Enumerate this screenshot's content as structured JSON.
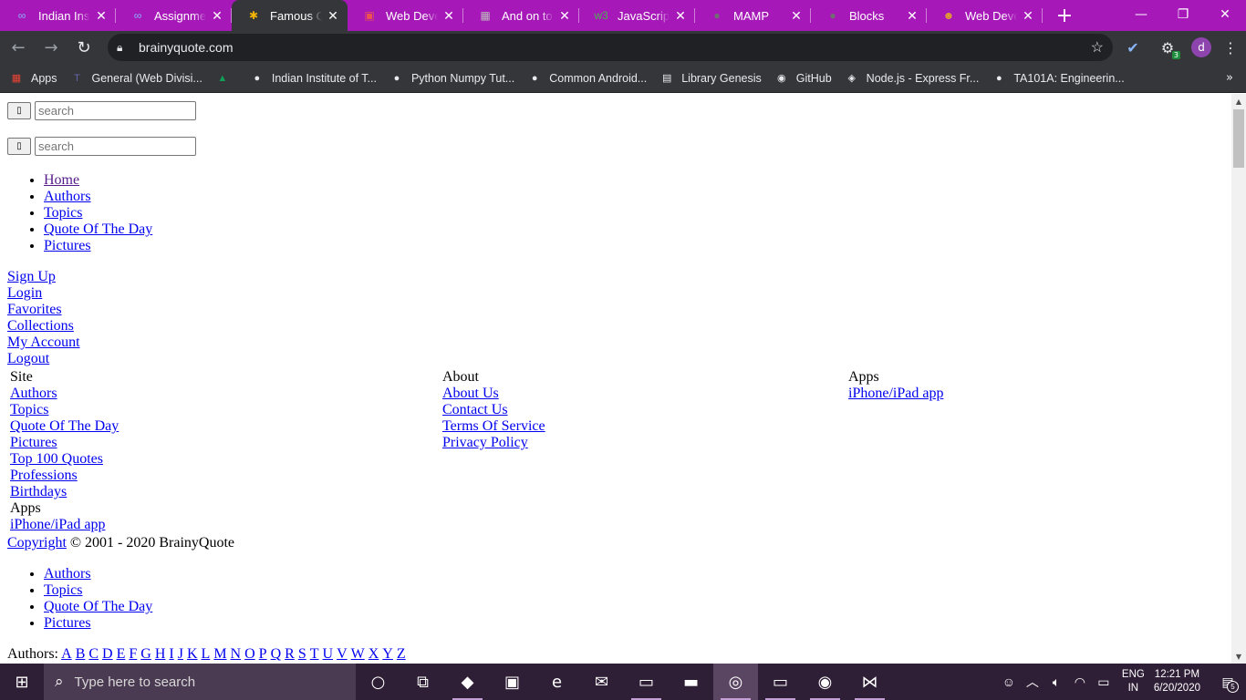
{
  "browser": {
    "tabs": [
      {
        "title": "Indian Institute",
        "favicon": "infinity-icon",
        "fav_glyph": "∞",
        "fav_color": "#8ab4f8",
        "active": false
      },
      {
        "title": "Assignment",
        "favicon": "infinity-icon",
        "fav_glyph": "∞",
        "fav_color": "#8ab4f8",
        "active": false
      },
      {
        "title": "Famous Quotes",
        "favicon": "pinwheel-icon",
        "fav_glyph": "✱",
        "fav_color": "#f4b400",
        "active": true
      },
      {
        "title": "Web Developer",
        "favicon": "udemy-icon",
        "fav_glyph": "▣",
        "fav_color": "#ec5252",
        "active": false
      },
      {
        "title": "And on to Git",
        "favicon": "portrait-icon",
        "fav_glyph": "▦",
        "fav_color": "#bbbbbb",
        "active": false
      },
      {
        "title": "JavaScript Tutorial",
        "favicon": "w3-icon",
        "fav_glyph": "w3",
        "fav_color": "#4caf50",
        "active": false
      },
      {
        "title": "MAMP",
        "favicon": "globe-icon",
        "fav_glyph": "●",
        "fav_color": "#6f6f6f",
        "active": false
      },
      {
        "title": "Blocks",
        "favicon": "globe-icon",
        "fav_glyph": "●",
        "fav_color": "#6f6f6f",
        "active": false
      },
      {
        "title": "Web Developer",
        "favicon": "cartoon-icon",
        "fav_glyph": "☻",
        "fav_color": "#e0a030",
        "active": false
      }
    ],
    "close_glyph": "✕",
    "new_tab_glyph": "+",
    "window_controls": {
      "minimize": "—",
      "restore": "❐",
      "close": "✕"
    },
    "url": "brainyquote.com",
    "bookmarks": [
      {
        "label": "Apps",
        "icon": "apps-grid-icon",
        "glyph": "▦",
        "color": "#ea4335"
      },
      {
        "label": "General (Web Divisi...",
        "icon": "teams-icon",
        "glyph": "T",
        "color": "#6264a7"
      },
      {
        "label": "",
        "icon": "google-drive-icon",
        "glyph": "▲",
        "color": "#0f9d58"
      },
      {
        "label": "Indian Institute of T...",
        "icon": "globe-icon",
        "glyph": "●",
        "color": "#e8eaed"
      },
      {
        "label": "Python Numpy Tut...",
        "icon": "globe-icon",
        "glyph": "●",
        "color": "#e8eaed"
      },
      {
        "label": "Common Android...",
        "icon": "globe-icon",
        "glyph": "●",
        "color": "#e8eaed"
      },
      {
        "label": "Library Genesis",
        "icon": "document-icon",
        "glyph": "▤",
        "color": "#e8eaed"
      },
      {
        "label": "GitHub",
        "icon": "github-icon",
        "glyph": "◉",
        "color": "#e8eaed"
      },
      {
        "label": "Node.js - Express Fr...",
        "icon": "nodejs-icon",
        "glyph": "◈",
        "color": "#e8eaed"
      },
      {
        "label": "TA101A: Engineerin...",
        "icon": "globe-icon",
        "glyph": "●",
        "color": "#e8eaed"
      }
    ],
    "bookmarks_more": "»",
    "extension_badge": "3",
    "profile_initial": "d"
  },
  "page": {
    "search_placeholder": "search",
    "search_button_glyph": "▯",
    "nav": [
      {
        "label": "Home",
        "visited": true
      },
      {
        "label": "Authors",
        "visited": false
      },
      {
        "label": "Topics",
        "visited": false
      },
      {
        "label": "Quote Of The Day",
        "visited": false
      },
      {
        "label": "Pictures",
        "visited": false
      }
    ],
    "account_links": [
      "Sign Up",
      "Login",
      "Favorites",
      "Collections",
      "My Account",
      "Logout"
    ],
    "footer": {
      "site": {
        "heading": "Site",
        "links": [
          "Authors",
          "Topics",
          "Quote Of The Day",
          "Pictures",
          "Top 100 Quotes",
          "Professions",
          "Birthdays"
        ]
      },
      "site_apps": {
        "heading": "Apps",
        "links": [
          "iPhone/iPad app"
        ]
      },
      "about": {
        "heading": "About",
        "links": [
          "About Us",
          "Contact Us",
          "Terms Of Service",
          "Privacy Policy"
        ]
      },
      "apps": {
        "heading": "Apps",
        "links": [
          "iPhone/iPad app"
        ]
      }
    },
    "copyright_link": "Copyright",
    "copyright_text": " © 2001 - 2020 BrainyQuote",
    "bottom_nav": [
      "Authors",
      "Topics",
      "Quote Of The Day",
      "Pictures"
    ],
    "authors_label": "Authors: ",
    "letters": [
      "A",
      "B",
      "C",
      "D",
      "E",
      "F",
      "G",
      "H",
      "I",
      "J",
      "K",
      "L",
      "M",
      "N",
      "O",
      "P",
      "Q",
      "R",
      "S",
      "T",
      "U",
      "V",
      "W",
      "X",
      "Y",
      "Z"
    ]
  },
  "taskbar": {
    "search_placeholder": "Type here to search",
    "apps": [
      {
        "name": "cortana-icon",
        "glyph": "○",
        "running": false,
        "active": false
      },
      {
        "name": "task-view-icon",
        "glyph": "⧉",
        "running": false,
        "active": false
      },
      {
        "name": "android-studio-icon",
        "glyph": "◆",
        "running": true,
        "active": false
      },
      {
        "name": "store-icon",
        "glyph": "▣",
        "running": false,
        "active": false
      },
      {
        "name": "edge-icon",
        "glyph": "e",
        "running": false,
        "active": false
      },
      {
        "name": "mail-icon",
        "glyph": "✉",
        "running": false,
        "active": false
      },
      {
        "name": "terminal-icon",
        "glyph": "▭",
        "running": true,
        "active": false
      },
      {
        "name": "file-explorer-icon",
        "glyph": "▬",
        "running": false,
        "active": false
      },
      {
        "name": "chrome-icon",
        "glyph": "◎",
        "running": true,
        "active": true
      },
      {
        "name": "terminal-icon",
        "glyph": "▭",
        "running": true,
        "active": false
      },
      {
        "name": "github-desktop-icon",
        "glyph": "◉",
        "running": true,
        "active": false
      },
      {
        "name": "vscode-icon",
        "glyph": "⋈",
        "running": true,
        "active": false
      }
    ],
    "lang_1": "ENG",
    "lang_2": "IN",
    "time": "12:21 PM",
    "date": "6/20/2020",
    "notification_count": "5"
  }
}
